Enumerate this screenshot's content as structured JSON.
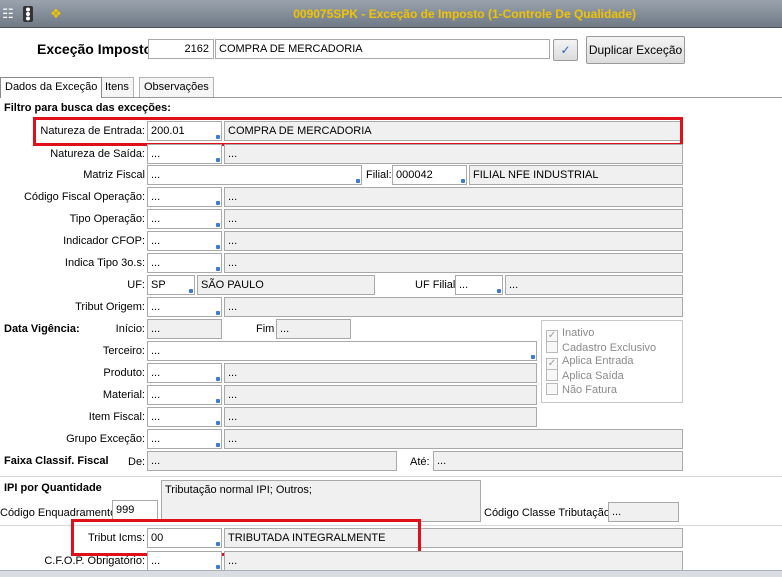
{
  "window": {
    "title": "009075SPK - Exceção de Imposto (1-Controle De Qualidade)"
  },
  "header": {
    "label": "Exceção Imposto",
    "code": "2162",
    "description": "COMPRA DE MERCADORIA",
    "duplicate_button": "Duplicar Exceção"
  },
  "tabs": [
    "Dados da Exceção",
    "Itens",
    "Observações"
  ],
  "section_filter": "Filtro para busca das exceções:",
  "fields": {
    "natureza_entrada": {
      "label": "Natureza de Entrada:",
      "code": "200.01",
      "desc": "COMPRA DE MERCADORIA"
    },
    "natureza_saida": {
      "label": "Natureza de Saída:",
      "code": "...",
      "desc": "..."
    },
    "matriz_fiscal": {
      "label": "Matriz Fiscal",
      "code": "..."
    },
    "filial": {
      "label": "Filial:",
      "code": "000042",
      "desc": "FILIAL NFE INDUSTRIAL"
    },
    "cfop_operacao": {
      "label": "Código Fiscal Operação:",
      "code": "...",
      "desc": "..."
    },
    "tipo_operacao": {
      "label": "Tipo Operação:",
      "code": "...",
      "desc": "..."
    },
    "indicador_cfop": {
      "label": "Indicador CFOP:",
      "code": "...",
      "desc": "..."
    },
    "indica_tipo": {
      "label": "Indica Tipo 3o.s:",
      "code": "...",
      "desc": "..."
    },
    "uf": {
      "label": "UF:",
      "code": "SP",
      "desc": "SÃO PAULO"
    },
    "uf_filial": {
      "label": "UF Filial",
      "code": "...",
      "desc": "..."
    },
    "tribut_origem": {
      "label": "Tribut Origem:",
      "code": "...",
      "desc": "..."
    },
    "terceiro": {
      "label": "Terceiro:",
      "code": "..."
    },
    "produto": {
      "label": "Produto:",
      "code": "...",
      "desc": "..."
    },
    "material": {
      "label": "Material:",
      "code": "...",
      "desc": "..."
    },
    "item_fiscal": {
      "label": "Item Fiscal:",
      "code": "...",
      "desc": "..."
    },
    "grupo_excecao": {
      "label": "Grupo Exceção:",
      "code": "...",
      "desc": "..."
    },
    "tribut_icms": {
      "label": "Tribut Icms:",
      "code": "00",
      "desc": "TRIBUTADA INTEGRALMENTE"
    },
    "cfop_obrigatorio": {
      "label": "C.F.O.P. Obrigatório:",
      "code": "...",
      "desc": "..."
    }
  },
  "vigencia": {
    "label": "Data Vigência:",
    "inicio_label": "Início:",
    "inicio": "...",
    "fim_label": "Fim",
    "fim": "..."
  },
  "checkboxes": [
    {
      "label": "Inativo",
      "checked": true
    },
    {
      "label": "Cadastro Exclusivo",
      "checked": false
    },
    {
      "label": "Aplica Entrada",
      "checked": true
    },
    {
      "label": "Aplica Saída",
      "checked": false
    },
    {
      "label": "Não Fatura",
      "checked": false
    }
  ],
  "faixa": {
    "label": "Faixa Classif. Fiscal",
    "de_label": "De:",
    "de": "...",
    "ate_label": "Até:",
    "ate": "..."
  },
  "ipi": {
    "label": "IPI por Quantidade",
    "tributacao_text": "Tributação normal IPI; Outros;",
    "enquadramento_label": "Código Enquadramento",
    "enquadramento": "999",
    "classe_label": "Código Classe Tributação",
    "classe": "..."
  },
  "icons": {
    "title_left": [
      "grid-icon",
      "traffic-light-icon",
      "wrench-icon"
    ],
    "confirm": "check-icon"
  },
  "colors": {
    "highlight": "#e0101a",
    "title_text": "#f2c300"
  }
}
